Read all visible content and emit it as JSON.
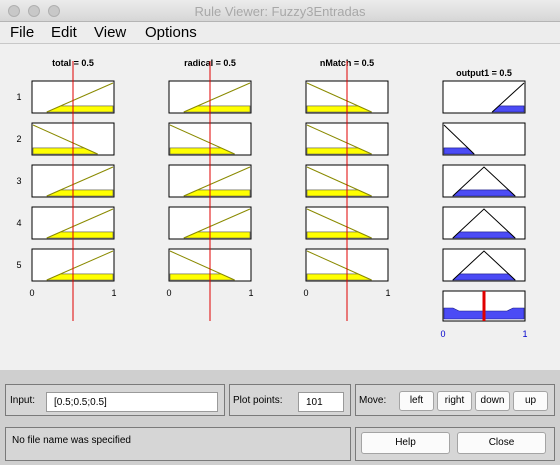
{
  "window": {
    "title": "Rule Viewer: Fuzzy3Entradas"
  },
  "menu": [
    {
      "label": "File"
    },
    {
      "label": "Edit"
    },
    {
      "label": "View"
    },
    {
      "label": "Options"
    }
  ],
  "rule_numbers": [
    "1",
    "2",
    "3",
    "4",
    "5"
  ],
  "inputs": [
    {
      "header": "total = 0.5",
      "value": 0.5,
      "tick_min": "0",
      "tick_max": "1",
      "rules": [
        {
          "mf": "ramp-up",
          "fill": 0.5
        },
        {
          "mf": "ramp-down",
          "fill": 0.5
        },
        {
          "mf": "ramp-up",
          "fill": 0.5
        },
        {
          "mf": "ramp-up",
          "fill": 0.5
        },
        {
          "mf": "ramp-up",
          "fill": 0.5
        }
      ]
    },
    {
      "header": "radical = 0.5",
      "value": 0.5,
      "tick_min": "0",
      "tick_max": "1",
      "rules": [
        {
          "mf": "ramp-up",
          "fill": 0.5
        },
        {
          "mf": "ramp-down",
          "fill": 0.5
        },
        {
          "mf": "ramp-up",
          "fill": 0.5
        },
        {
          "mf": "ramp-up",
          "fill": 0.5
        },
        {
          "mf": "ramp-down",
          "fill": 0.5
        }
      ]
    },
    {
      "header": "nMatch = 0.5",
      "value": 0.5,
      "tick_min": "0",
      "tick_max": "1",
      "rules": [
        {
          "mf": "ramp-down",
          "fill": 0.5
        },
        {
          "mf": "ramp-down",
          "fill": 0.5
        },
        {
          "mf": "ramp-down",
          "fill": 0.5
        },
        {
          "mf": "ramp-down",
          "fill": 0.5
        },
        {
          "mf": "ramp-down",
          "fill": 0.5
        }
      ]
    }
  ],
  "output": {
    "header": "output1 = 0.5",
    "value": 0.5,
    "tick_min": "0",
    "tick_max": "1",
    "rules": [
      {
        "mf": "ramp-up",
        "fill": 0.5
      },
      {
        "mf": "ramp-down",
        "fill": 0.5
      },
      {
        "mf": "triangle",
        "fill": 0.5
      },
      {
        "mf": "triangle",
        "fill": 0.5
      },
      {
        "mf": "triangle",
        "fill": 0.5
      }
    ]
  },
  "controls": {
    "input_label": "Input:",
    "input_value": "[0.5;0.5;0.5]",
    "plot_points_label": "Plot points:",
    "plot_points_value": "101",
    "move_label": "Move:",
    "move_buttons": [
      "left",
      "right",
      "down",
      "up"
    ],
    "status": "No file name was specified",
    "help_label": "Help",
    "close_label": "Close"
  },
  "colors": {
    "input_fill": "#ffff00",
    "output_fill": "#4b4bf5",
    "indicator_line": "#e00000",
    "mf_line": "#8a8a00"
  }
}
